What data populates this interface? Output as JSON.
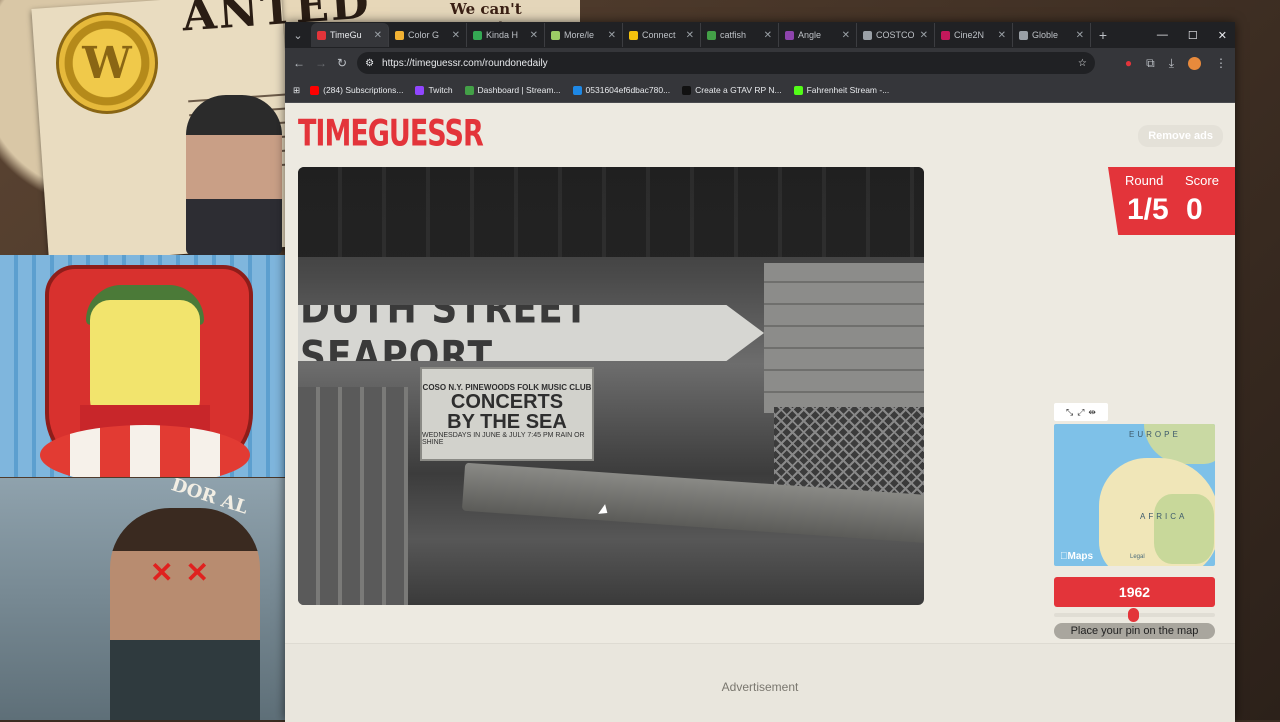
{
  "overlay": {
    "poster_title": "ANTED",
    "poster_caption": "We can't expect",
    "badge_letter": "W",
    "ring_text": "DOR AL"
  },
  "browser": {
    "tabs": [
      {
        "label": "TimeGu",
        "color": "#e3343a",
        "active": true
      },
      {
        "label": "Color G",
        "color": "#f2b233"
      },
      {
        "label": "Kinda H",
        "color": "#34a853"
      },
      {
        "label": "More/le",
        "color": "#9ccc65"
      },
      {
        "label": "Connect",
        "color": "#f4c20d"
      },
      {
        "label": "catfish",
        "color": "#43a047"
      },
      {
        "label": "Angle",
        "color": "#8e44ad"
      },
      {
        "label": "COSTCO",
        "color": "#9aa0a6"
      },
      {
        "label": "Cine2N",
        "color": "#c2185b"
      },
      {
        "label": "Globle",
        "color": "#9aa0a6"
      }
    ],
    "new_tab": "+",
    "url": "https://timeguessr.com/roundonedaily",
    "bookmarks": [
      {
        "label": "(284) Subscriptions...",
        "color": "#ff0000"
      },
      {
        "label": "Twitch",
        "color": "#9146ff"
      },
      {
        "label": "Dashboard | Stream...",
        "color": "#43a047"
      },
      {
        "label": "0531604ef6dbac780...",
        "color": "#1e88e5"
      },
      {
        "label": "Create a GTAV RP N...",
        "color": "#111111"
      },
      {
        "label": "Fahrenheit Stream -...",
        "color": "#53fc18"
      }
    ]
  },
  "page": {
    "logo": "TIMEGUESSR",
    "remove_ads": "Remove ads",
    "photo_sign": "DUTH STREET SEAPORT",
    "poster_line1": "COSO N.Y. PINEWOODS FOLK MUSIC CLUB",
    "poster_line2": "CONCERTS",
    "poster_line3": "BY THE SEA",
    "poster_line4": "WEDNESDAYS IN JUNE & JULY 7:45 PM RAIN OR SHINE",
    "round_label": "Round",
    "round_value": "1/5",
    "score_label": "Score",
    "score_value": "0",
    "map_label_europe": "EUROPE",
    "map_label_africa": "AFRICA",
    "maps_credit": "Maps",
    "maps_legal": "Legal",
    "year": "1962",
    "year_slider_fraction": 0.49,
    "pin_button": "Place your pin on the map",
    "advertisement": "Advertisement"
  },
  "colors": {
    "accent": "#e3343a",
    "page_bg": "#edeae1"
  }
}
